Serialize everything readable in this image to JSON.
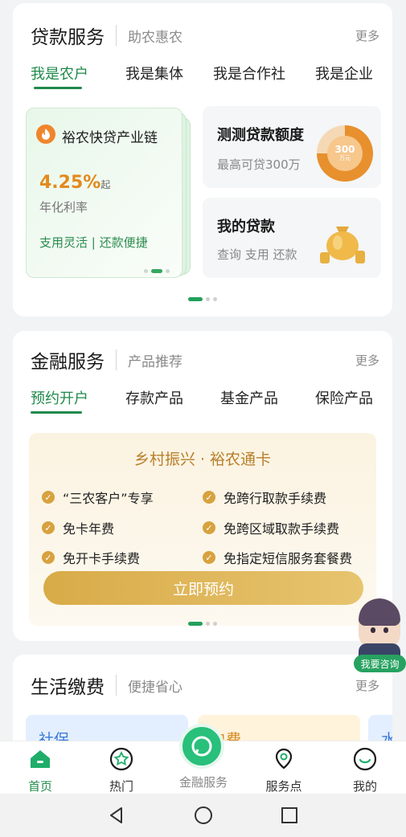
{
  "colors": {
    "accent": "#1f8a4a",
    "orange": "#e38a1c",
    "gold": "#d7a23f"
  },
  "loan": {
    "title": "贷款服务",
    "subtitle": "助农惠农",
    "more": "更多",
    "tabs": [
      "我是农户",
      "我是集体",
      "我是合作社",
      "我是企业"
    ],
    "product": {
      "name": "裕农快贷产业链",
      "rate": "4.25%",
      "rate_suffix": "起",
      "rate_label": "年化利率",
      "features": "支用灵活 | 还款便捷"
    },
    "quota": {
      "title": "测测贷款额度",
      "desc": "最高可贷300万",
      "gauge_value": "300",
      "gauge_unit": "万元"
    },
    "my_loan": {
      "title": "我的贷款",
      "desc": "查询 支用 还款"
    }
  },
  "finance": {
    "title": "金融服务",
    "subtitle": "产品推荐",
    "more": "更多",
    "tabs": [
      "预约开户",
      "存款产品",
      "基金产品",
      "保险产品"
    ],
    "promo": {
      "title": "乡村振兴 · 裕农通卡",
      "features": [
        "“三农客户”专享",
        "免跨行取款手续费",
        "免卡年费",
        "免跨区域取款手续费",
        "免开卡手续费",
        "免指定短信服务套餐费"
      ],
      "cta": "立即预约"
    }
  },
  "life": {
    "title": "生活缴费",
    "subtitle": "便捷省心",
    "more": "更多",
    "cards": [
      "社保",
      "电费",
      "水"
    ]
  },
  "advisor": {
    "label": "我要咨询"
  },
  "nav": {
    "items": [
      "首页",
      "热门",
      "金融服务",
      "服务点",
      "我的"
    ],
    "active": "首页"
  },
  "icons": [
    "flame-icon",
    "gauge-icon",
    "money-bag-icon",
    "check-icon",
    "home-icon",
    "flower-icon",
    "chat-icon",
    "location-icon",
    "smile-icon",
    "back-icon",
    "home-circle-icon",
    "recents-icon"
  ]
}
